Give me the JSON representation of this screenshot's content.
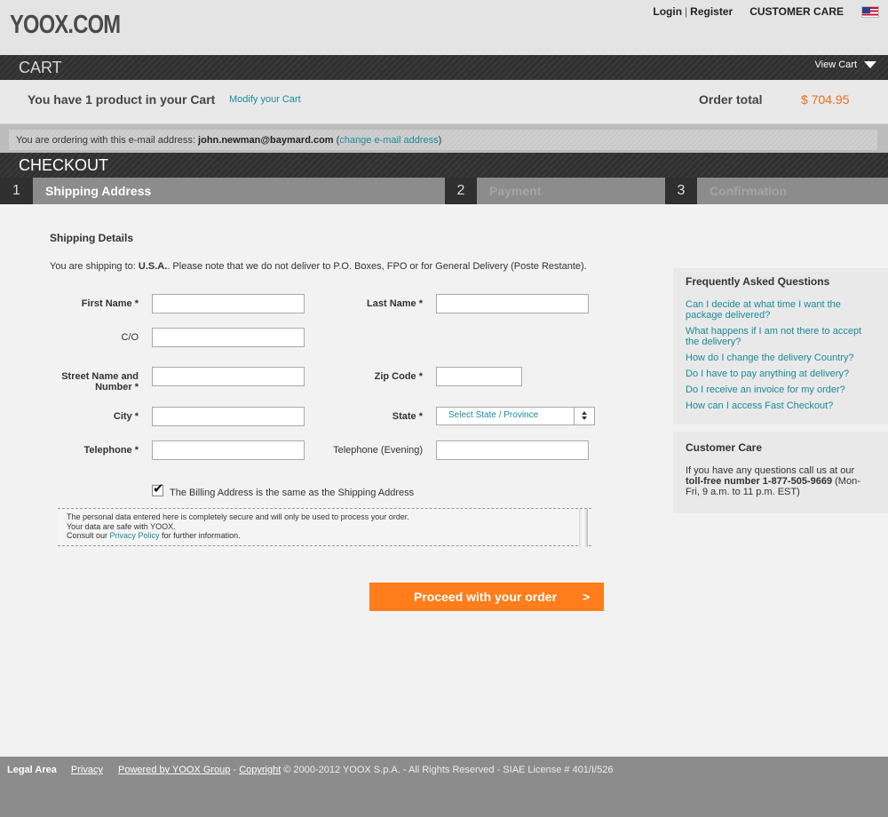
{
  "header": {
    "logo": "YOOX.COM",
    "login": "Login",
    "separator": "|",
    "register": "Register",
    "customer_care": "CUSTOMER CARE",
    "flag_icon": "us-flag-icon"
  },
  "cart_bar": {
    "title": "CART",
    "view_cart": "View Cart"
  },
  "summary": {
    "message": "You have 1 product in your Cart",
    "modify_link": "Modify your Cart",
    "order_total_label": "Order total",
    "order_total_value": "$ 704.95",
    "accent_color": "#f26a1b"
  },
  "email": {
    "prefix": "You are ordering with this e-mail address:",
    "address": "john.newman@baymard.com",
    "open": "(",
    "change_link": "change e-mail address",
    "close": ")"
  },
  "checkout": {
    "title": "CHECKOUT",
    "steps": [
      {
        "num": "1",
        "label": "Shipping Address"
      },
      {
        "num": "2",
        "label": "Payment"
      },
      {
        "num": "3",
        "label": "Confirmation"
      }
    ]
  },
  "form": {
    "section_title": "Shipping Details",
    "ship_prefix": "You are shipping to:",
    "ship_country": "U.S.A.",
    "ship_note": ". Please note that we do not deliver to P.O. Boxes, FPO or for General Delivery (Poste Restante).",
    "first_name": "First Name *",
    "last_name": "Last Name *",
    "co": "C/O",
    "street_line1": "Street Name and",
    "street_line2": "Number *",
    "zip": "Zip Code *",
    "city": "City *",
    "state": "State *",
    "state_select": "Select State / Province",
    "telephone": "Telephone *",
    "telephone_evening": "Telephone (Evening)",
    "billing_same": "The Billing Address is the same as the Shipping Address",
    "billing_checked": true,
    "privacy_line1": "The personal data entered here is completely secure and will only be used to process your order.",
    "privacy_line2": "Your data are safe with YOOX.",
    "privacy_line3_pre": "Consult our",
    "privacy_link": "Privacy Policy",
    "privacy_line3_post": "for further information.",
    "proceed_button": "Proceed with your order",
    "proceed_arrow": ">",
    "button_color": "#ff7d1a"
  },
  "faq": {
    "title": "Frequently Asked Questions",
    "questions": [
      "Can I decide at what time I want the package delivered?",
      "What happens if I am not there to accept the delivery?",
      "How do I change the delivery Country?",
      "Do I have to pay anything at delivery?",
      "Do I receive an invoice for my order?",
      "How can I access Fast Checkout?"
    ]
  },
  "customer_care": {
    "title": "Customer Care",
    "text_pre": "If you have any questions call us at our",
    "text_bold": "toll-free number 1-877-505-9669",
    "text_post": "(Mon-Fri, 9 a.m. to 11 p.m. EST)"
  },
  "footer": {
    "legal_area": "Legal Area",
    "privacy": "Privacy",
    "powered": "Powered by YOOX Group",
    "dash": "-",
    "copyright_link": "Copyright",
    "copyright_text": "© 2000-2012 YOOX S.p.A. - All Rights Reserved - SIAE License # 401/I/526"
  }
}
